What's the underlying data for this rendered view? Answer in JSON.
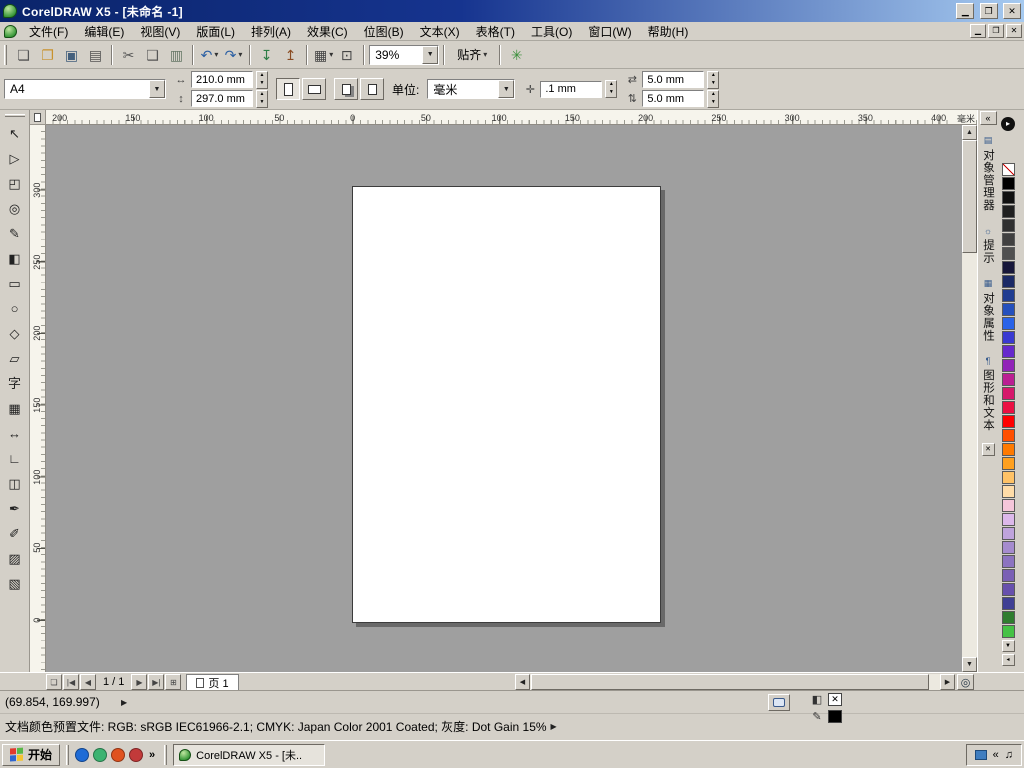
{
  "colors": {
    "chrome": "#d4d0c8",
    "title_start": "#0a246a",
    "title_end": "#a6caf0",
    "canvas": "#9f9f9f",
    "page": "#ffffff",
    "options_green": "#3a8f3a"
  },
  "glyphs": {
    "combo_arrow": "▼",
    "spin_up": "▲",
    "spin_down": "▼",
    "menu_arrow": "▾"
  },
  "window": {
    "title": "CorelDRAW X5 - [未命名 -1]",
    "minimize_glyph": "▁",
    "restore_glyph": "❐",
    "close_glyph": "✕"
  },
  "menu": {
    "items": [
      "文件(F)",
      "编辑(E)",
      "视图(V)",
      "版面(L)",
      "排列(A)",
      "效果(C)",
      "位图(B)",
      "文本(X)",
      "表格(T)",
      "工具(O)",
      "窗口(W)",
      "帮助(H)"
    ]
  },
  "toolbar": {
    "file_buttons": [
      {
        "name": "new-button",
        "icon": "new-document-icon",
        "glyph": "❏",
        "color": "#555555"
      },
      {
        "name": "open-button",
        "icon": "open-folder-icon",
        "glyph": "❐",
        "color": "#c8922e"
      },
      {
        "name": "save-button",
        "icon": "save-disk-icon",
        "glyph": "▣",
        "color": "#44607d"
      },
      {
        "name": "print-button",
        "icon": "printer-icon",
        "glyph": "▤",
        "color": "#555555"
      }
    ],
    "clipboard_buttons": [
      {
        "name": "cut-button",
        "icon": "scissors-icon",
        "glyph": "✂",
        "color": "#555555"
      },
      {
        "name": "copy-button",
        "icon": "copy-icon",
        "glyph": "❑",
        "color": "#555555"
      },
      {
        "name": "paste-button",
        "icon": "paste-icon",
        "glyph": "▥",
        "color": "#667766"
      }
    ],
    "history_buttons": [
      {
        "name": "undo-button",
        "icon": "undo-arrow-icon",
        "glyph": "↶",
        "arrow": "▾",
        "color": "#2b5fa3"
      },
      {
        "name": "redo-button",
        "icon": "redo-arrow-icon",
        "glyph": "↷",
        "arrow": "▾",
        "color": "#2b5fa3"
      }
    ],
    "transfer_buttons": [
      {
        "name": "import-button",
        "icon": "import-icon",
        "glyph": "↧",
        "color": "#2e7d46"
      },
      {
        "name": "export-button",
        "icon": "export-icon",
        "glyph": "↥",
        "color": "#8a4b22"
      }
    ],
    "launcher_buttons": [
      {
        "name": "application-launcher-button",
        "icon": "app-launcher-icon",
        "glyph": "▦",
        "arrow": "▾",
        "color": "#444444"
      },
      {
        "name": "welcome-screen-button",
        "icon": "welcome-screen-icon",
        "glyph": "⊡",
        "color": "#444444"
      }
    ],
    "zoom_value": "39%",
    "snap_label": "贴齐",
    "options_glyph": "✳"
  },
  "property_bar": {
    "preset": "A4",
    "paper_width": "210.0 mm",
    "paper_height": "297.0 mm",
    "width_icon_glyph": "↔",
    "height_icon_glyph": "↕",
    "units_label": "单位:",
    "units_value": "毫米",
    "nudge_icon_glyph": "✛",
    "nudge_value": ".1 mm",
    "dup_x_icon_glyph": "⇄",
    "dup_y_icon_glyph": "⇅",
    "duplicate_x": "5.0 mm",
    "duplicate_y": "5.0 mm"
  },
  "rulers": {
    "h_labels": [
      "200",
      "150",
      "100",
      "50",
      "0",
      "50",
      "100",
      "150",
      "200",
      "250",
      "300",
      "350",
      "400"
    ],
    "v_labels": [
      "300",
      "250",
      "200",
      "150",
      "100",
      "50",
      "0"
    ],
    "unit_label": "毫米"
  },
  "toolbox": {
    "tools": [
      {
        "name": "pick-tool",
        "icon": "pick-arrow-icon",
        "glyph": "↖"
      },
      {
        "name": "shape-tool",
        "icon": "shape-node-icon",
        "glyph": "▷"
      },
      {
        "name": "crop-tool",
        "icon": "crop-frame-icon",
        "glyph": "◰"
      },
      {
        "name": "zoom-tool",
        "icon": "magnifier-icon",
        "glyph": "◎"
      },
      {
        "name": "freehand-tool",
        "icon": "pencil-curve-icon",
        "glyph": "✎"
      },
      {
        "name": "smart-fill-tool",
        "icon": "smart-fill-icon",
        "glyph": "◧"
      },
      {
        "name": "rectangle-tool",
        "icon": "rectangle-icon",
        "glyph": "▭"
      },
      {
        "name": "ellipse-tool",
        "icon": "ellipse-icon",
        "glyph": "○"
      },
      {
        "name": "polygon-tool",
        "icon": "polygon-icon",
        "glyph": "◇"
      },
      {
        "name": "basic-shapes-tool",
        "icon": "basic-shapes-icon",
        "glyph": "▱"
      },
      {
        "name": "text-tool",
        "icon": "text-icon",
        "glyph": "字"
      },
      {
        "name": "table-tool",
        "icon": "table-grid-icon",
        "glyph": "▦"
      },
      {
        "name": "dimension-tool",
        "icon": "dimension-icon",
        "glyph": "↔"
      },
      {
        "name": "connector-tool",
        "icon": "connector-icon",
        "glyph": "∟"
      },
      {
        "name": "blend-tool",
        "icon": "blend-icon",
        "glyph": "◫"
      },
      {
        "name": "color-eyedropper-tool",
        "icon": "eyedropper-icon",
        "glyph": "✒"
      },
      {
        "name": "outline-pen-tool",
        "icon": "outline-pen-icon",
        "glyph": "✐"
      },
      {
        "name": "fill-tool",
        "icon": "fill-bucket-icon",
        "glyph": "▨"
      },
      {
        "name": "interactive-fill-tool",
        "icon": "interactive-fill-icon",
        "glyph": "▧"
      }
    ]
  },
  "dockers": {
    "collapse_glyph": "«",
    "close_glyph": "✕",
    "tabs": [
      {
        "name": "docker-tab-object-manager",
        "icon": "object-manager-icon",
        "icon_glyph": "▤",
        "label": "对象管理器"
      },
      {
        "name": "docker-tab-hints",
        "icon": "hints-icon",
        "icon_glyph": "☼",
        "label": "提示"
      },
      {
        "name": "docker-tab-object-properties",
        "icon": "object-properties-icon",
        "icon_glyph": "▦",
        "label": "对象属性"
      },
      {
        "name": "docker-tab-graphic-text",
        "icon": "graphic-text-icon",
        "icon_glyph": "¶",
        "label": "图形和文本"
      }
    ]
  },
  "palette": {
    "customize_glyph": "▸",
    "none_glyph": "✕",
    "flyout_glyph": "◂",
    "colors": [
      "#000000",
      "#101010",
      "#202020",
      "#303030",
      "#404040",
      "#505050",
      "#17173a",
      "#1b2a66",
      "#203d91",
      "#2450bd",
      "#2963e8",
      "#3a3ad1",
      "#6629cc",
      "#9124b8",
      "#bb1f93",
      "#d6186b",
      "#eb1043",
      "#ff0000",
      "#ff4f00",
      "#ff7a00",
      "#ffa01f",
      "#ffc266",
      "#ffdca8",
      "#f5c6da",
      "#dcb8ea",
      "#bfa3dc",
      "#a58bce",
      "#8c73c0",
      "#7a60b5",
      "#6750ad",
      "#3f3f94",
      "#2f7d2f",
      "#45c245"
    ]
  },
  "navbar": {
    "page_flip_glyph": "❏",
    "first_glyph": "|◀",
    "prev_glyph": "◀",
    "page_indicator": "1 / 1",
    "next_glyph": "▶",
    "last_glyph": "▶|",
    "add_page_glyph": "⊞",
    "page_tab_label": "页 1",
    "left_glyph": "◀",
    "right_glyph": "▶",
    "navigator_glyph": "◎"
  },
  "status": {
    "coords": "(69.854, 169.997)",
    "arrow_glyph": "▶",
    "profile": "文档颜色预置文件: RGB: sRGB IEC61966-2.1; CMYK: Japan Color 2001 Coated; 灰度: Dot Gain 15%",
    "fill_icon_glyph": "◧",
    "outline_icon_glyph": "✎",
    "none_glyph": "✕"
  },
  "taskbar": {
    "start_label": "开始",
    "overflow_glyph": "»",
    "task_label": "CorelDRAW X5 - [未..",
    "tray_chevron": "«",
    "volume_glyph": "♫",
    "quick_launch": [
      {
        "name": "quick-launch-browser-icon",
        "color": "#1e6bd6"
      },
      {
        "name": "quick-launch-media-icon",
        "color": "#3cb371"
      },
      {
        "name": "quick-launch-firefox-icon",
        "color": "#e0521f"
      },
      {
        "name": "quick-launch-mail-icon",
        "color": "#c23a3a"
      }
    ]
  }
}
